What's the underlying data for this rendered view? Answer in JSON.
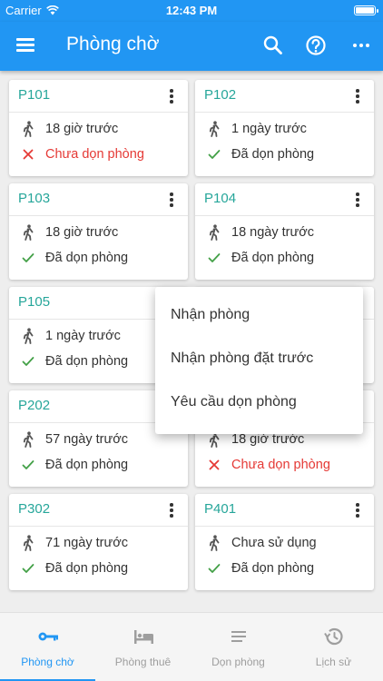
{
  "status_bar": {
    "carrier": "Carrier",
    "time": "12:43 PM"
  },
  "app_bar": {
    "title": "Phòng chờ",
    "icons": [
      "menu-icon",
      "search-icon",
      "help-icon",
      "more-vertical-icon"
    ]
  },
  "rooms": [
    {
      "name": "P101",
      "time": "18 giờ trước",
      "status": "Chưa dọn phòng",
      "clean": false
    },
    {
      "name": "P102",
      "time": "1 ngày trước",
      "status": "Đã dọn phòng",
      "clean": true
    },
    {
      "name": "P103",
      "time": "18 giờ trước",
      "status": "Đã dọn phòng",
      "clean": true
    },
    {
      "name": "P104",
      "time": "18 ngày trước",
      "status": "Đã dọn phòng",
      "clean": true
    },
    {
      "name": "P105",
      "time": "1 ngày trước",
      "status": "Đã dọn phòng",
      "clean": true
    },
    {
      "name": "",
      "time": "",
      "status": "",
      "clean": true
    },
    {
      "name": "P202",
      "time": "57 ngày trước",
      "status": "Đã dọn phòng",
      "clean": true
    },
    {
      "name": "",
      "time": "18 giờ trước",
      "status": "Chưa dọn phòng",
      "clean": false
    },
    {
      "name": "P302",
      "time": "71 ngày trước",
      "status": "Đã dọn phòng",
      "clean": true
    },
    {
      "name": "P401",
      "time": "Chưa sử dụng",
      "status": "Đã dọn phòng",
      "clean": true
    }
  ],
  "popup_menu": {
    "items": [
      "Nhận phòng",
      "Nhận phòng đặt trước",
      "Yêu cầu dọn phòng"
    ]
  },
  "tabs": [
    {
      "label": "Phòng chờ",
      "icon": "key-icon",
      "active": true
    },
    {
      "label": "Phòng thuê",
      "icon": "bed-icon",
      "active": false
    },
    {
      "label": "Dọn phòng",
      "icon": "lines-icon",
      "active": false
    },
    {
      "label": "Lịch sử",
      "icon": "history-icon",
      "active": false
    }
  ],
  "colors": {
    "primary": "#2196f3",
    "room_name": "#26a69a",
    "clean_check": "#43a047",
    "dirty": "#e53935"
  }
}
